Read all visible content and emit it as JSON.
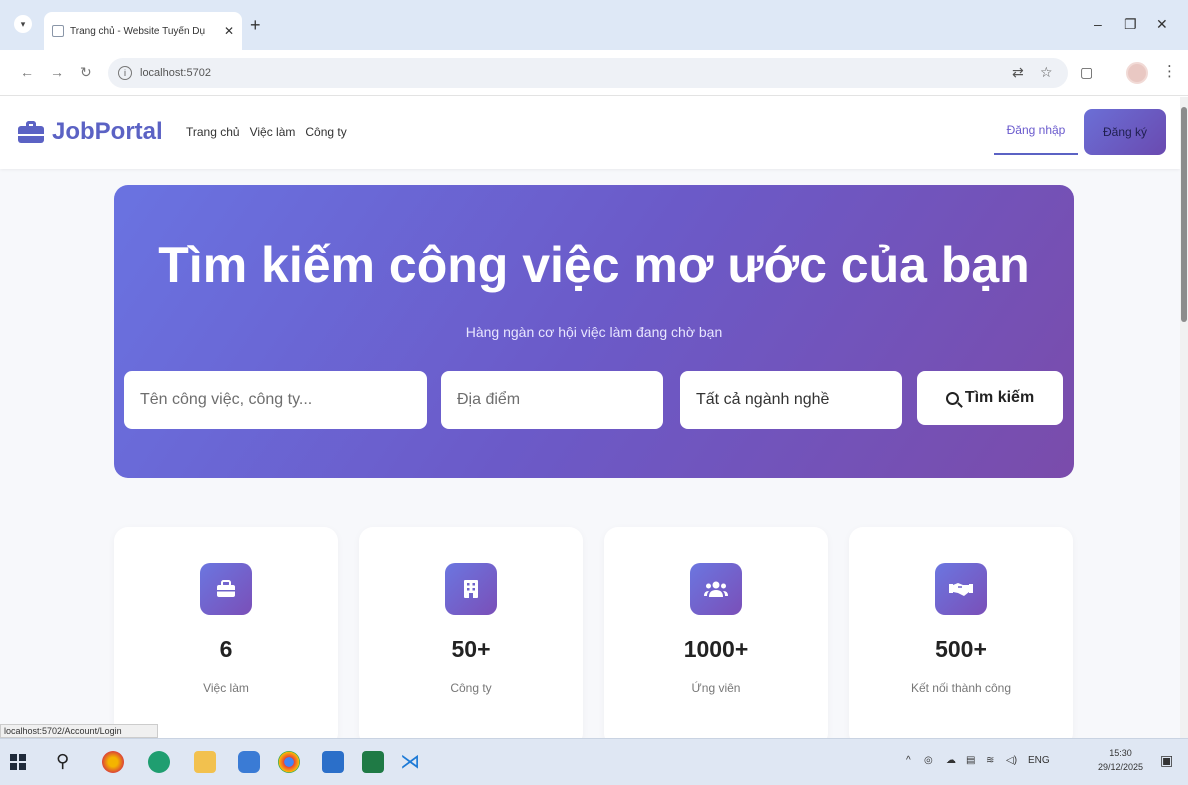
{
  "browser": {
    "tab_title": "Trang chủ - Website Tuyển Dụ",
    "url": "localhost:5702",
    "status_url": "localhost:5702/Account/Login"
  },
  "navbar": {
    "brand": "JobPortal",
    "links": [
      "Trang chủ",
      "Việc làm",
      "Công ty"
    ],
    "login": "Đăng nhập",
    "register": "Đăng ký"
  },
  "hero": {
    "title": "Tìm kiếm công việc mơ ước của bạn",
    "subtitle": "Hàng ngàn cơ hội việc làm đang chờ bạn",
    "keyword_placeholder": "Tên công việc, công ty...",
    "location_placeholder": "Địa điểm",
    "category_selected": "Tất cả ngành nghề",
    "search_button": "Tìm kiếm"
  },
  "stats": [
    {
      "value": "6",
      "label": "Việc làm",
      "icon": "briefcase-icon"
    },
    {
      "value": "50+",
      "label": "Công ty",
      "icon": "building-icon"
    },
    {
      "value": "1000+",
      "label": "Ứng viên",
      "icon": "users-icon"
    },
    {
      "value": "500+",
      "label": "Kết nối thành công",
      "icon": "handshake-icon"
    }
  ],
  "taskbar": {
    "language": "ENG",
    "time": "15:30",
    "date": "29/12/2025"
  },
  "colors": {
    "brand": "#5b62c4",
    "hero_start": "#6a73e1",
    "hero_end": "#7a4cab"
  }
}
